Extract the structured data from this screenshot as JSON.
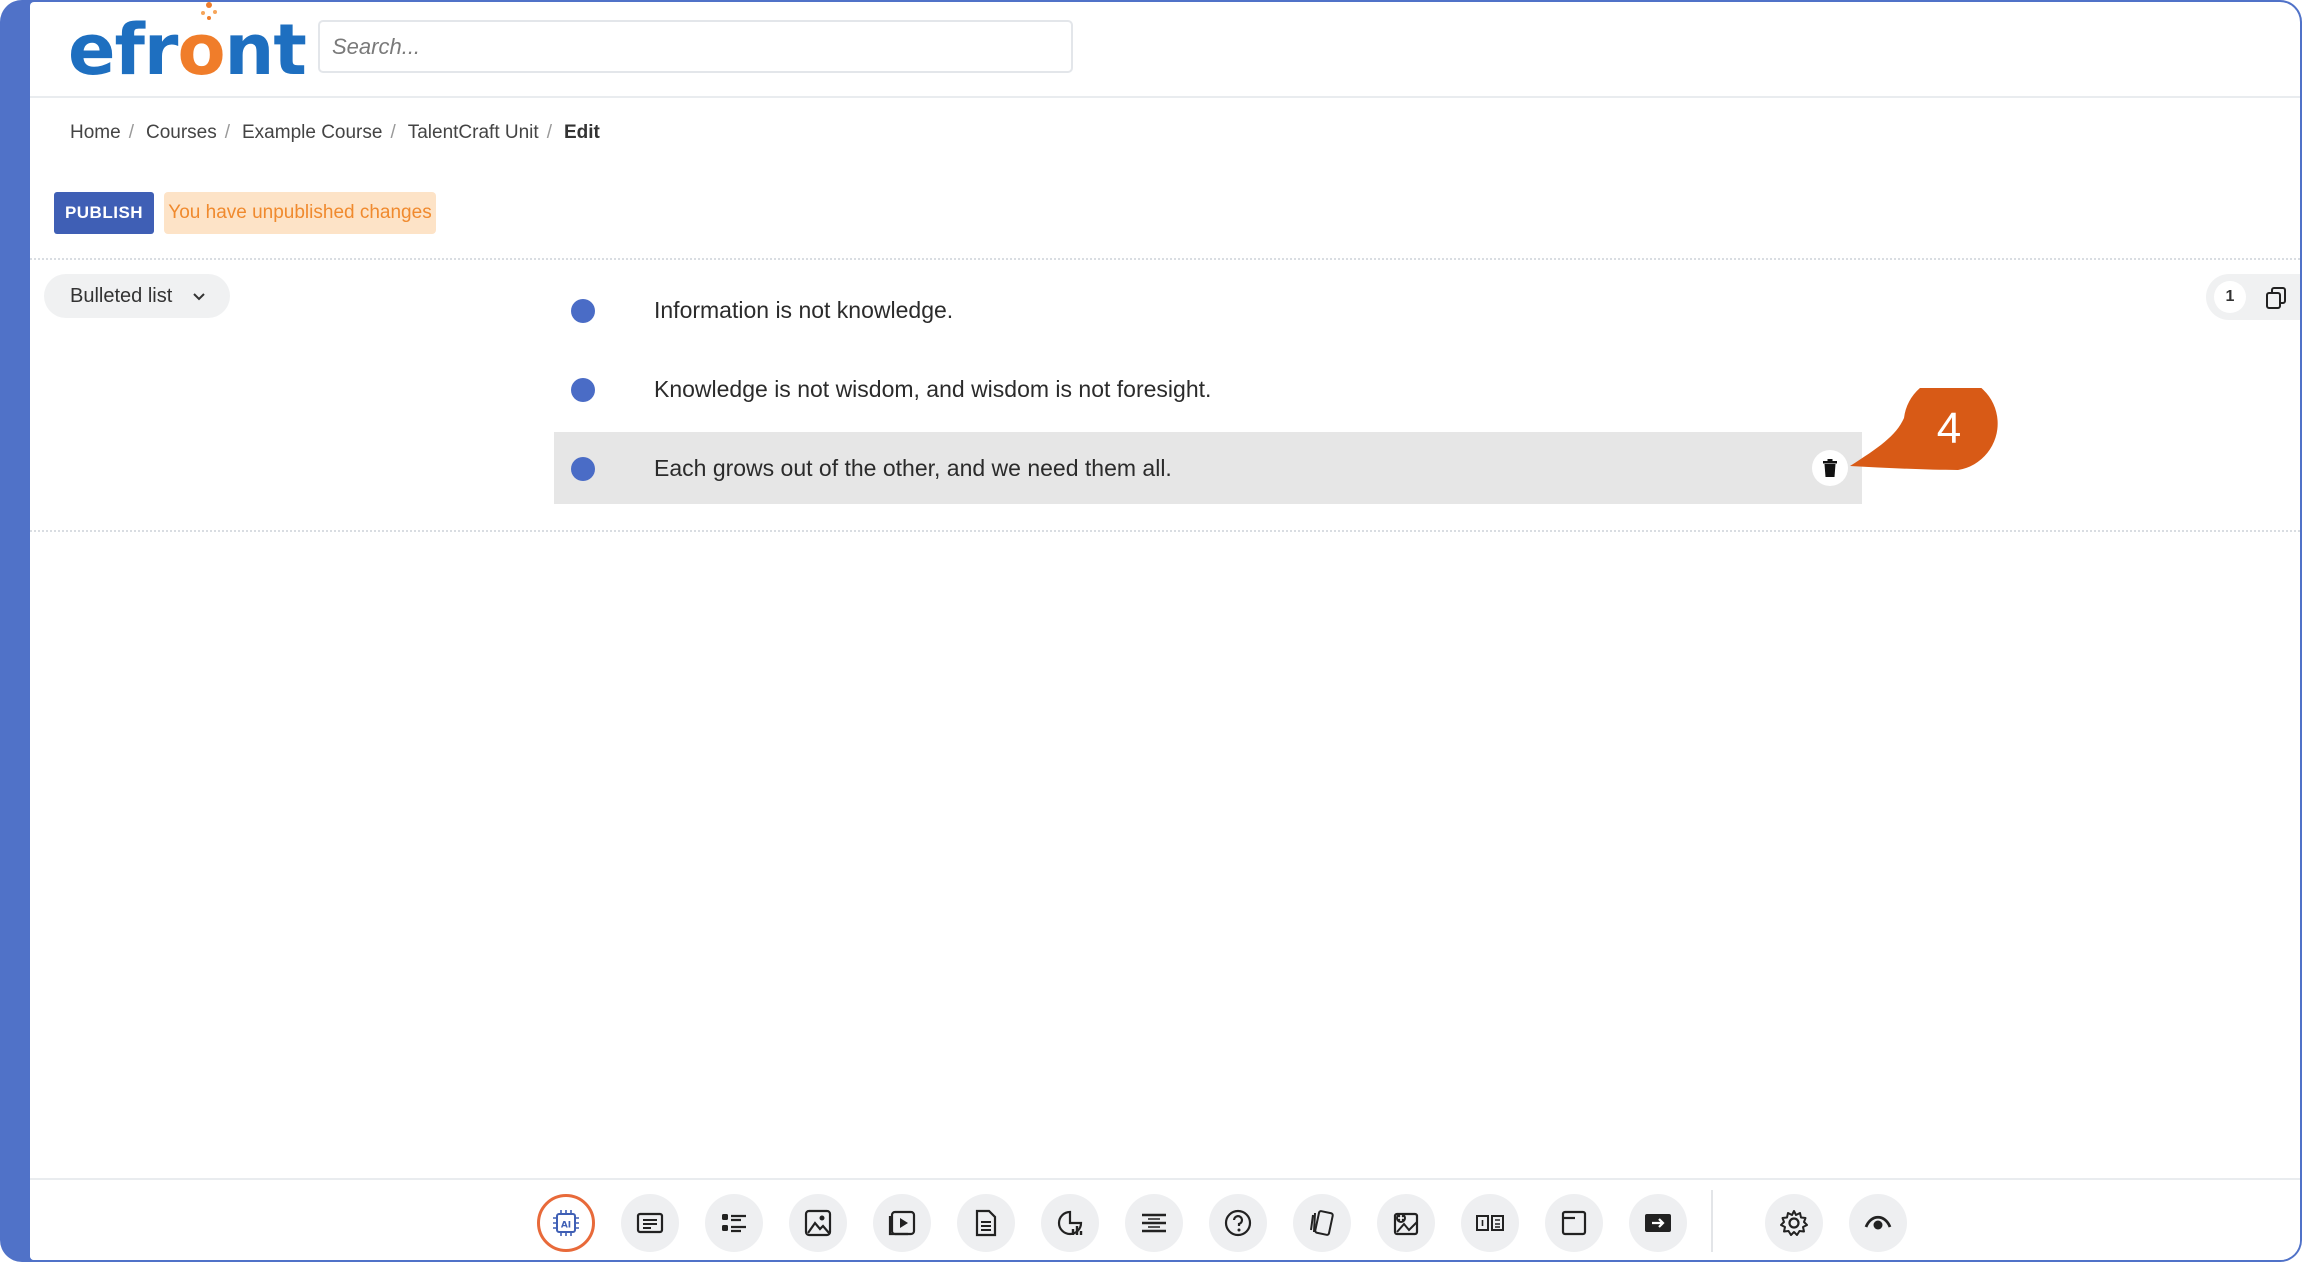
{
  "header": {
    "logo_prefix": "efr",
    "logo_o": "o",
    "logo_suffix": "nt",
    "search_placeholder": "Search..."
  },
  "breadcrumb": {
    "items": [
      "Home",
      "Courses",
      "Example Course",
      "TalentCraft Unit"
    ],
    "separator": "/",
    "current": "Edit"
  },
  "publish": {
    "button_label": "PUBLISH",
    "notice": "You have unpublished changes"
  },
  "block": {
    "type_label": "Bulleted list",
    "page_number": "1",
    "items": [
      "Information is not knowledge.",
      "Knowledge is not wisdom, and wisdom is not foresight.",
      "Each grows out of the other, and we need them all."
    ],
    "active_item_index": 2
  },
  "callout": {
    "number": "4",
    "color": "#d85a16"
  },
  "colors": {
    "accent": "#4a6cc6",
    "publish": "#3f5fb5",
    "notice_bg": "#fde3c7",
    "notice_text": "#f08a2e",
    "logo_blue": "#1e6fc0",
    "logo_orange": "#f07d2a"
  },
  "toolbar": {
    "tools": [
      "ai-icon",
      "text-icon",
      "bulleted-list-icon",
      "image-icon",
      "video-icon",
      "document-icon",
      "chart-icon",
      "lines-icon",
      "question-icon",
      "flashcards-icon",
      "image-hotspot-icon",
      "columns-icon",
      "window-icon",
      "embed-icon",
      "settings-icon",
      "preview-icon"
    ]
  }
}
